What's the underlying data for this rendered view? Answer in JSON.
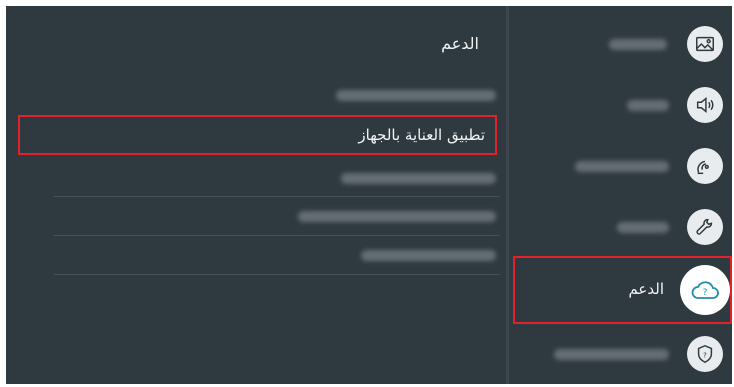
{
  "sidebar": {
    "items": [
      {
        "icon": "picture-icon"
      },
      {
        "icon": "sound-icon"
      },
      {
        "icon": "broadcast-icon"
      },
      {
        "icon": "wrench-icon"
      },
      {
        "icon": "support-cloud-icon",
        "label": "الدعم",
        "selected": true
      },
      {
        "icon": "privacy-shield-icon"
      }
    ]
  },
  "panel": {
    "title": "الدعم",
    "items": [
      {
        "label": ""
      },
      {
        "label": "تطبيق العناية بالجهاز",
        "selected": true
      },
      {
        "label": ""
      },
      {
        "label": ""
      },
      {
        "label": ""
      }
    ]
  },
  "colors": {
    "background": "#2f3a40",
    "highlight": "#e0222a",
    "text": "#f2f4f5"
  }
}
